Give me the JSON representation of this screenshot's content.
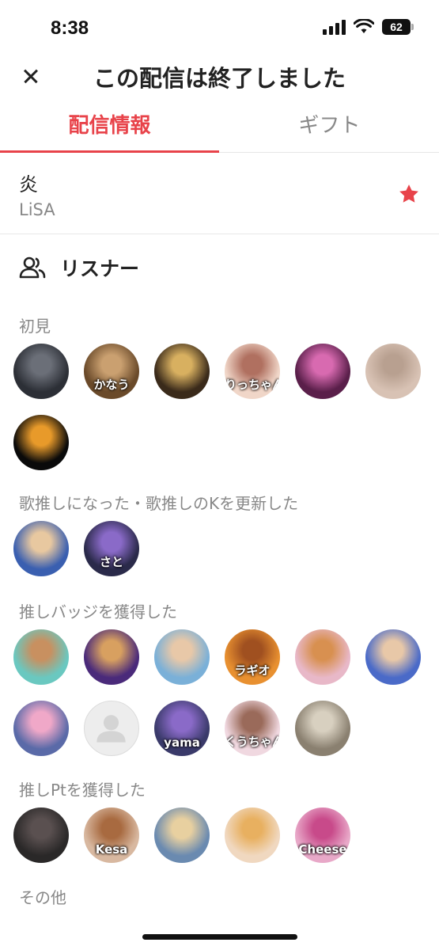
{
  "status_bar": {
    "time": "8:38",
    "battery": "62"
  },
  "header": {
    "title": "この配信は終了しました",
    "close_icon": "close-icon"
  },
  "tabs": [
    {
      "label": "配信情報",
      "active": true
    },
    {
      "label": "ギフト",
      "active": false
    }
  ],
  "song": {
    "title": "炎",
    "artist": "LiSA",
    "favorite_icon": "star-icon"
  },
  "listeners": {
    "heading": "リスナー",
    "sections": [
      {
        "label": "初見",
        "avatars": [
          {
            "bg": "#2c2f36",
            "fg": "#6b6f78",
            "text": ""
          },
          {
            "bg": "#6a4a2a",
            "fg": "#caa070",
            "text": "かなう"
          },
          {
            "bg": "#3a2a1a",
            "fg": "#d8b060",
            "text": ""
          },
          {
            "bg": "#f0d6c8",
            "fg": "#b07060",
            "text": "りっちゃん"
          },
          {
            "bg": "#5a1f4a",
            "fg": "#d86ab0",
            "text": ""
          },
          {
            "bg": "#d8c2b4",
            "fg": "#b8a090",
            "text": ""
          },
          {
            "bg": "#0a0a0a",
            "fg": "#e89a2a",
            "text": ""
          }
        ]
      },
      {
        "label": "歌推しになった・歌推しのKを更新した",
        "avatars": [
          {
            "bg": "#3a5fb0",
            "fg": "#e8c8a0",
            "text": ""
          },
          {
            "bg": "#2a2a4a",
            "fg": "#8a6ac8",
            "text": "さと"
          }
        ]
      },
      {
        "label": "推しバッジを獲得した",
        "avatars": [
          {
            "bg": "#6ac8c0",
            "fg": "#c89060",
            "text": ""
          },
          {
            "bg": "#4a2a7a",
            "fg": "#d8a060",
            "text": ""
          },
          {
            "bg": "#7ab0d8",
            "fg": "#e8c8a8",
            "text": ""
          },
          {
            "bg": "#e89030",
            "fg": "#a05020",
            "text": "ラギオ"
          },
          {
            "bg": "#e8b8c8",
            "fg": "#d89050",
            "text": ""
          },
          {
            "bg": "#4a6ac8",
            "fg": "#e8c8a8",
            "text": ""
          },
          {
            "bg": "#5a6aa8",
            "fg": "#f0a8c8",
            "text": ""
          },
          {
            "bg": "#ededed",
            "fg": "#d4d4d4",
            "text": "",
            "placeholder": true
          },
          {
            "bg": "#3a3a6a",
            "fg": "#8a6ac8",
            "text": "yama"
          },
          {
            "bg": "#f0d8e0",
            "fg": "#9a6a5a",
            "text": "くうちゃん"
          },
          {
            "bg": "#8a8070",
            "fg": "#d8d0c0",
            "text": ""
          }
        ]
      },
      {
        "label": "推しPtを獲得した",
        "avatars": [
          {
            "bg": "#2a2828",
            "fg": "#5a5050",
            "text": ""
          },
          {
            "bg": "#d8b8a0",
            "fg": "#a86a40",
            "text": "Kesa"
          },
          {
            "bg": "#6a8ab0",
            "fg": "#e8d0a0",
            "text": ""
          },
          {
            "bg": "#f0d8c0",
            "fg": "#e8b060",
            "text": ""
          },
          {
            "bg": "#e8a8c8",
            "fg": "#c84a8a",
            "text": "Cheese"
          }
        ]
      },
      {
        "label": "その他",
        "avatars": []
      }
    ]
  }
}
